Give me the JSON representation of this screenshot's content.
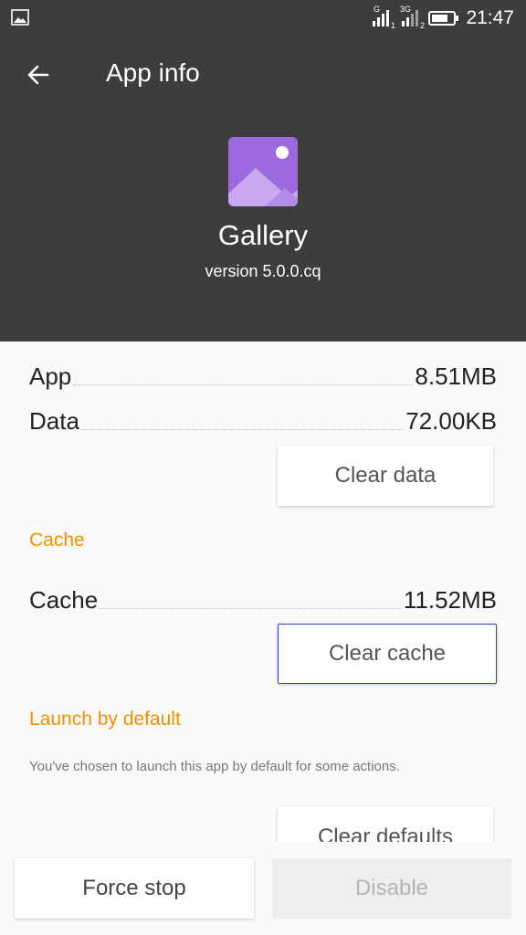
{
  "status_bar": {
    "time": "21:47",
    "sim1_label": "G",
    "sim2_label": "3G",
    "sim1_index": "1",
    "sim2_index": "2",
    "battery_level": 0.75,
    "icons": [
      "image-icon",
      "signal-icon",
      "signal-icon",
      "battery-icon"
    ]
  },
  "header": {
    "title": "App info",
    "app_name": "Gallery",
    "app_version": "version 5.0.0.cq",
    "accent": "#9c6ade"
  },
  "storage": {
    "app_label": "App",
    "app_value": "8.51MB",
    "data_label": "Data",
    "data_value": "72.00KB",
    "clear_data_label": "Clear data"
  },
  "cache": {
    "section_title": "Cache",
    "cache_label": "Cache",
    "cache_value": "11.52MB",
    "clear_cache_label": "Clear cache"
  },
  "launch": {
    "section_title": "Launch by default",
    "description": "You've chosen to launch this app by default for some actions.",
    "clear_defaults_label": "Clear defaults"
  },
  "actions": {
    "force_stop_label": "Force stop",
    "disable_label": "Disable"
  },
  "colors": {
    "header_bg": "#3d3d3d",
    "section_title": "#f29000",
    "focus_border": "#3b3bc9"
  }
}
